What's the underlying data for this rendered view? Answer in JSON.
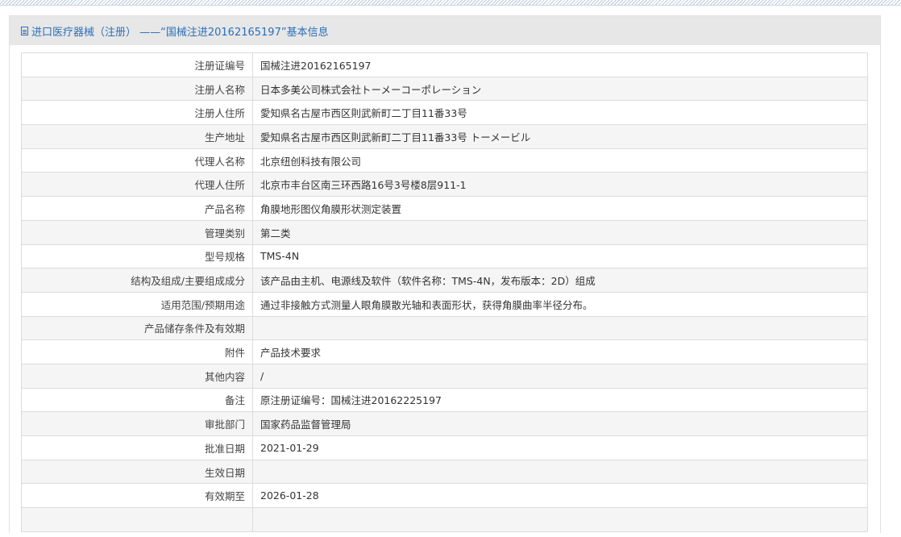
{
  "header": {
    "title": "进口医疗器械（注册） ——“国械注进20162165197”基本信息"
  },
  "rows": [
    {
      "label": "注册证编号",
      "value": "国械注进20162165197"
    },
    {
      "label": "注册人名称",
      "value": "日本多美公司株式会社トーメーコーポレーション"
    },
    {
      "label": "注册人住所",
      "value": "愛知県名古屋市西区則武新町二丁目11番33号"
    },
    {
      "label": "生产地址",
      "value": "愛知県名古屋市西区則武新町二丁目11番33号 トーメービル"
    },
    {
      "label": "代理人名称",
      "value": "北京纽创科技有限公司"
    },
    {
      "label": "代理人住所",
      "value": "北京市丰台区南三环西路16号3号楼8层911-1"
    },
    {
      "label": "产品名称",
      "value": "角膜地形图仪角膜形状测定装置"
    },
    {
      "label": "管理类别",
      "value": "第二类"
    },
    {
      "label": "型号规格",
      "value": "TMS-4N"
    },
    {
      "label": "结构及组成/主要组成成分",
      "value": "该产品由主机、电源线及软件（软件名称：TMS-4N，发布版本：2D）组成"
    },
    {
      "label": "适用范围/预期用途",
      "value": "通过非接触方式测量人眼角膜散光轴和表面形状，获得角膜曲率半径分布。"
    },
    {
      "label": "产品储存条件及有效期",
      "value": ""
    },
    {
      "label": "附件",
      "value": "产品技术要求"
    },
    {
      "label": "其他内容",
      "value": "/"
    },
    {
      "label": "备注",
      "value": "原注册证编号：国械注进20162225197"
    },
    {
      "label": "审批部门",
      "value": "国家药品监督管理局"
    },
    {
      "label": "批准日期",
      "value": "2021-01-29"
    },
    {
      "label": "生效日期",
      "value": ""
    },
    {
      "label": "有效期至",
      "value": "2026-01-28"
    },
    {
      "label": "",
      "value": ""
    }
  ]
}
